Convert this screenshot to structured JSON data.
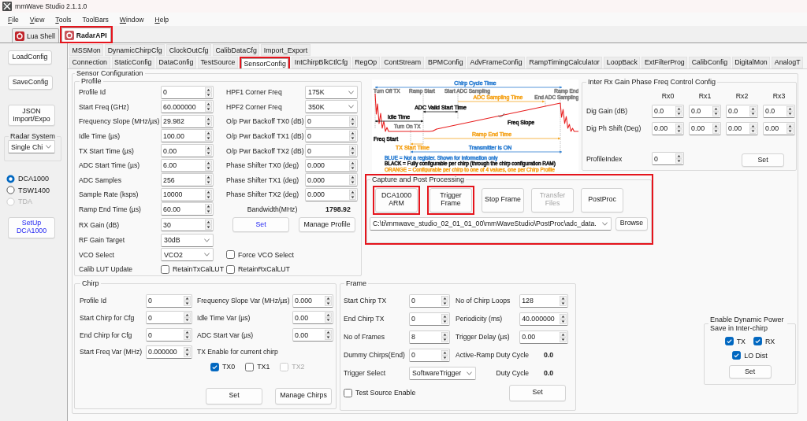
{
  "window": {
    "title": "mmWave Studio 2.1.1.0"
  },
  "menu": [
    {
      "label": "File",
      "mnemonic": true
    },
    {
      "label": "View",
      "mnemonic": true
    },
    {
      "label": "Tools",
      "mnemonic": true
    },
    {
      "label": "ToolBars",
      "mnemonic": false
    },
    {
      "label": "Window",
      "mnemonic": true
    },
    {
      "label": "Help",
      "mnemonic": true
    }
  ],
  "doc_tabs": [
    {
      "label": "Lua Shell",
      "selected": false,
      "highlighted": false
    },
    {
      "label": "RadarAPI",
      "selected": true,
      "highlighted": true
    }
  ],
  "sidebar": {
    "buttons": [
      "LoadConfig",
      "SaveConfig",
      "JSON Import/Expo"
    ],
    "radar_system": {
      "title": "Radar System",
      "value": "Single Chi"
    },
    "capture_devices": [
      {
        "label": "DCA1000",
        "selected": true,
        "disabled": false
      },
      {
        "label": "TSW1400",
        "selected": false,
        "disabled": false
      },
      {
        "label": "TDA",
        "selected": false,
        "disabled": true
      }
    ],
    "setup_button": {
      "label": "SetUp DCA1000",
      "accent": true
    }
  },
  "tab_rows": [
    [
      {
        "label": "MSSMon",
        "selected": false,
        "highlighted": false
      },
      {
        "label": "DynamicChirpCfg",
        "selected": false,
        "highlighted": false
      },
      {
        "label": "ClockOutCfg",
        "selected": false,
        "highlighted": false
      },
      {
        "label": "CalibDataCfg",
        "selected": false,
        "highlighted": false
      },
      {
        "label": "Import_Export",
        "selected": false,
        "highlighted": false
      }
    ],
    [
      {
        "label": "Connection",
        "selected": false,
        "highlighted": false
      },
      {
        "label": "StaticConfig",
        "selected": false,
        "highlighted": false
      },
      {
        "label": "DataConfig",
        "selected": false,
        "highlighted": false
      },
      {
        "label": "TestSource",
        "selected": false,
        "highlighted": false
      },
      {
        "label": "SensorConfig",
        "selected": true,
        "highlighted": true
      },
      {
        "label": "IntChirpBlkCtlCfg",
        "selected": false,
        "highlighted": false
      },
      {
        "label": "RegOp",
        "selected": false,
        "highlighted": false
      },
      {
        "label": "ContStream",
        "selected": false,
        "highlighted": false
      },
      {
        "label": "BPMConfig",
        "selected": false,
        "highlighted": false
      },
      {
        "label": "AdvFrameConfig",
        "selected": false,
        "highlighted": false
      },
      {
        "label": "RampTimingCalculator",
        "selected": false,
        "highlighted": false
      },
      {
        "label": "LoopBack",
        "selected": false,
        "highlighted": false
      },
      {
        "label": "ExtFilterProg",
        "selected": false,
        "highlighted": false
      },
      {
        "label": "CalibConfig",
        "selected": false,
        "highlighted": false
      },
      {
        "label": "DigitalMon",
        "selected": false,
        "highlighted": false
      },
      {
        "label": "AnalogT",
        "selected": false,
        "highlighted": false
      }
    ]
  ],
  "sensor_config": {
    "title": "Sensor Configuration",
    "profile": {
      "title": "Profile",
      "rows": [
        {
          "left": {
            "kind": "spin",
            "label": "Profile Id",
            "value": "0"
          },
          "right": {
            "kind": "select",
            "label": "HPF1 Corner Freq",
            "value": "175K"
          }
        },
        {
          "left": {
            "kind": "spin",
            "label": "Start Freq (GHz)",
            "value": "60.000000"
          },
          "right": {
            "kind": "select",
            "label": "HPF2 Corner Freq",
            "value": "350K"
          }
        },
        {
          "left": {
            "kind": "spin",
            "label": "Frequency Slope (MHz/µs)",
            "value": "29.982"
          },
          "right": {
            "kind": "spin",
            "label": "O/p Pwr Backoff TX0 (dB)",
            "value": "0"
          }
        },
        {
          "left": {
            "kind": "spin",
            "label": "Idle Time (µs)",
            "value": "100.00"
          },
          "right": {
            "kind": "spin",
            "label": "O/p Pwr Backoff TX1 (dB)",
            "value": "0"
          }
        },
        {
          "left": {
            "kind": "spin",
            "label": "TX Start Time (µs)",
            "value": "0.00"
          },
          "right": {
            "kind": "spin",
            "label": "O/p Pwr Backoff TX2 (dB)",
            "value": "0"
          }
        },
        {
          "left": {
            "kind": "spin",
            "label": "ADC Start Time (µs)",
            "value": "6.00"
          },
          "right": {
            "kind": "spin",
            "label": "Phase Shifter TX0 (deg)",
            "value": "0.000"
          }
        },
        {
          "left": {
            "kind": "spin",
            "label": "ADC Samples",
            "value": "256"
          },
          "right": {
            "kind": "spin",
            "label": "Phase Shifter TX1 (deg)",
            "value": "0.000"
          }
        },
        {
          "left": {
            "kind": "spin",
            "label": "Sample Rate (ksps)",
            "value": "10000"
          },
          "right": {
            "kind": "spin",
            "label": "Phase Shifter TX2 (deg)",
            "value": "0.000"
          }
        },
        {
          "left": {
            "kind": "spin",
            "label": "Ramp End Time (µs)",
            "value": "60.00"
          },
          "right": {
            "kind": "reading",
            "label": "Bandwidth(MHz)",
            "value": "1798.92"
          }
        },
        {
          "left": {
            "kind": "spin",
            "label": "RX Gain (dB)",
            "value": "30"
          },
          "right": {
            "kind": "buttons",
            "buttons": [
              {
                "label": "Set",
                "accent": true
              },
              {
                "label": "Manage Profile",
                "accent": false
              }
            ]
          }
        },
        {
          "left": {
            "kind": "select",
            "label": "RF Gain Target",
            "value": "30dB"
          }
        },
        {
          "left": {
            "kind": "select",
            "label": "VCO Select",
            "value": "VCO2"
          },
          "right": {
            "kind": "check",
            "text": "Force VCO Select",
            "checked": false
          }
        },
        {
          "left": {
            "kind": "check",
            "label": "Calib LUT Update",
            "text": "RetainTxCalLUT",
            "checked": false
          },
          "right": {
            "kind": "check",
            "text": "RetainRxCalLUT",
            "checked": false
          }
        }
      ]
    },
    "timing_diagram": {
      "labels": [
        {
          "text": "Chirp Cycle Time",
          "kind": "dimension",
          "color": "#2e7fd2"
        },
        {
          "text": "Turn Off TX",
          "kind": "marker",
          "color": "#808080"
        },
        {
          "text": "Ramp Start",
          "kind": "marker",
          "color": "#808080"
        },
        {
          "text": "Start ADC Sampling",
          "kind": "marker",
          "color": "#808080"
        },
        {
          "text": "Ramp End",
          "kind": "marker",
          "color": "#808080"
        },
        {
          "text": "ADC Sampling Time",
          "kind": "dimension",
          "color": "#f5a623"
        },
        {
          "text": "End ADC Sampling",
          "kind": "marker",
          "color": "#808080"
        },
        {
          "text": "ADC Valid Start Time",
          "kind": "dimension",
          "color": "#1a1a1a"
        },
        {
          "text": "Idle Time",
          "kind": "dimension",
          "color": "#1a1a1a"
        },
        {
          "text": "Freq Slope",
          "kind": "dimension",
          "color": "#1a1a1a"
        },
        {
          "text": "Turn On TX",
          "kind": "marker",
          "color": "#808080"
        },
        {
          "text": "Freq Start",
          "kind": "dimension",
          "color": "#1a1a1a"
        },
        {
          "text": "Ramp End Time",
          "kind": "dimension",
          "color": "#f5a623"
        },
        {
          "text": "TX Start Time",
          "kind": "dimension",
          "color": "#f5a623"
        },
        {
          "text": "Transmitter is ON",
          "kind": "dimension",
          "color": "#2e7fd2"
        },
        {
          "text": "BLUE = Not a register. Shown for information only",
          "kind": "legend",
          "color": "#2e7fd2"
        },
        {
          "text": "BLACK = Fully configurable per chirp (through the chirp configuration RAM)",
          "kind": "legend",
          "color": "#1a1a1a"
        },
        {
          "text": "ORANGE = Configurable per chirp to one of 4 values, one per Chirp Profile",
          "kind": "legend",
          "color": "#f5a623"
        }
      ]
    },
    "inter_rx": {
      "title": "Inter Rx Gain Phase Freq Control Config",
      "columns": [
        "Rx0",
        "Rx1",
        "Rx2",
        "Rx3"
      ],
      "rows": [
        {
          "label": "Dig Gain (dB)",
          "values": [
            "0.0",
            "0.0",
            "0.0",
            "0.0"
          ]
        },
        {
          "label": "Dig Ph Shift (Deg)",
          "values": [
            "0.00",
            "0.00",
            "0.00",
            "0.00"
          ]
        }
      ],
      "profile_index": {
        "label": "ProfileIndex",
        "value": "0"
      },
      "button": "Set"
    },
    "capture": {
      "title": "Capture and Post Processing",
      "highlighted": true,
      "buttons": [
        {
          "label": "DCA1000 ARM",
          "disabled": false,
          "highlighted": true
        },
        {
          "label": "Trigger Frame",
          "disabled": false,
          "highlighted": true
        },
        {
          "label": "Stop Frame",
          "disabled": false,
          "highlighted": false
        },
        {
          "label": "Transfer Files",
          "disabled": true,
          "highlighted": false
        },
        {
          "label": "PostProc",
          "disabled": false,
          "highlighted": false
        }
      ],
      "path": "C:\\ti\\mmwave_studio_02_01_01_00\\mmWaveStudio\\PostProc\\adc_data.",
      "browse": "Browse"
    },
    "chirp": {
      "title": "Chirp",
      "rows": [
        {
          "left": {
            "kind": "spin",
            "label": "Profile Id",
            "value": "0"
          },
          "right": {
            "kind": "spin",
            "label": "Frequency Slope Var (MHz/µs)",
            "value": "0.000"
          }
        },
        {
          "left": {
            "kind": "spin",
            "label": "Start Chirp for Cfg",
            "value": "0"
          },
          "right": {
            "kind": "spin",
            "label": "Idle Time Var (µs)",
            "value": "0.00"
          }
        },
        {
          "left": {
            "kind": "spin",
            "label": "End Chirp for Cfg",
            "value": "0"
          },
          "right": {
            "kind": "spin",
            "label": "ADC Start Var (µs)",
            "value": "0.00"
          }
        },
        {
          "left": {
            "kind": "spin",
            "label": "Start Freq Var (MHz)",
            "value": "0.000000"
          },
          "right": {
            "kind": "note",
            "label": "TX Enable for current chirp"
          }
        }
      ],
      "tx_enable": [
        {
          "label": "TX0",
          "checked": true,
          "disabled": false
        },
        {
          "label": "TX1",
          "checked": false,
          "disabled": false
        },
        {
          "label": "TX2",
          "checked": false,
          "disabled": true
        }
      ],
      "buttons": [
        {
          "label": "Set",
          "accent": false
        },
        {
          "label": "Manage Chirps",
          "accent": false
        }
      ]
    },
    "frame": {
      "title": "Frame",
      "rows": [
        {
          "left": {
            "kind": "spin",
            "label": "Start Chirp TX",
            "value": "0"
          },
          "right": {
            "kind": "spin",
            "label": "No of Chirp Loops",
            "value": "128"
          }
        },
        {
          "left": {
            "kind": "spin",
            "label": "End Chirp TX",
            "value": "0"
          },
          "right": {
            "kind": "spin",
            "label": "Periodicity (ms)",
            "value": "40.000000"
          }
        },
        {
          "left": {
            "kind": "spin",
            "label": "No of Frames",
            "value": "8"
          },
          "right": {
            "kind": "spin",
            "label": "Trigger Delay (µs)",
            "value": "0.00"
          }
        },
        {
          "left": {
            "kind": "spin",
            "label": "Dummy Chirps(End)",
            "value": "0"
          },
          "right": {
            "kind": "reading",
            "label": "Active-Ramp Duty Cycle",
            "value": "0.0"
          }
        },
        {
          "left": {
            "kind": "select",
            "label": "Trigger Select",
            "value": "SoftwareTrigger"
          },
          "right": {
            "kind": "reading",
            "label": "Duty Cycle",
            "value": "0.0"
          }
        },
        {
          "left": {
            "kind": "check",
            "text": "Test Source Enable",
            "checked": false
          },
          "right": {
            "kind": "buttons",
            "buttons": [
              {
                "label": "Set",
                "accent": false
              }
            ]
          }
        }
      ]
    },
    "power_save": {
      "title": "Enable Dynamic Power Save in Inter-chirp",
      "options": [
        {
          "label": "TX",
          "checked": true
        },
        {
          "label": "RX",
          "checked": true
        },
        {
          "label": "LO Dist",
          "checked": true
        }
      ],
      "button": "Set"
    }
  }
}
